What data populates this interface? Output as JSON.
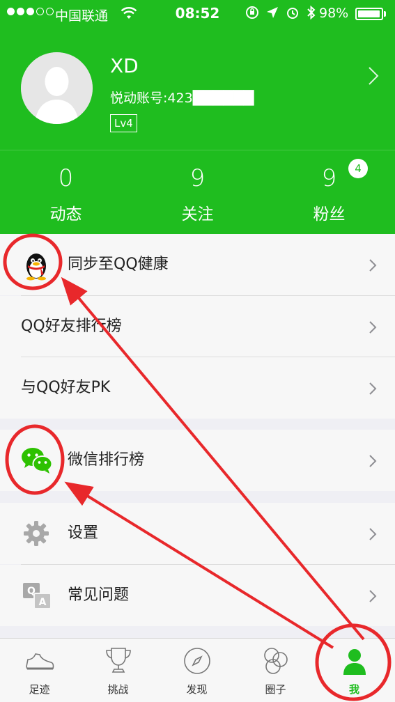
{
  "status_bar": {
    "carrier": "中国联通",
    "time": "08:52",
    "battery": "98%",
    "battery_level": 0.98
  },
  "profile": {
    "name": "XD",
    "account": "悦动账号:423██████",
    "level": "Lv4",
    "avatar_icon": "person-silhouette-icon"
  },
  "stats": [
    {
      "value": "0",
      "label": "动态"
    },
    {
      "value": "9",
      "label": "关注"
    },
    {
      "value": "9",
      "label": "粉丝",
      "badge": "4"
    }
  ],
  "menu": {
    "qq_health": "同步至QQ健康",
    "qq_rank": "QQ好友排行榜",
    "qq_pk": "与QQ好友PK",
    "wechat_rank": "微信排行榜",
    "settings": "设置",
    "faq": "常见问题"
  },
  "tabs": [
    {
      "label": "足迹",
      "icon": "sneaker-icon"
    },
    {
      "label": "挑战",
      "icon": "trophy-icon"
    },
    {
      "label": "发现",
      "icon": "compass-icon"
    },
    {
      "label": "圈子",
      "icon": "rings-icon"
    },
    {
      "label": "我",
      "icon": "person-icon",
      "active": true
    }
  ],
  "colors": {
    "brand_green": "#1fbd1f",
    "annotation_red": "#e8282b",
    "background": "#efeff4"
  }
}
